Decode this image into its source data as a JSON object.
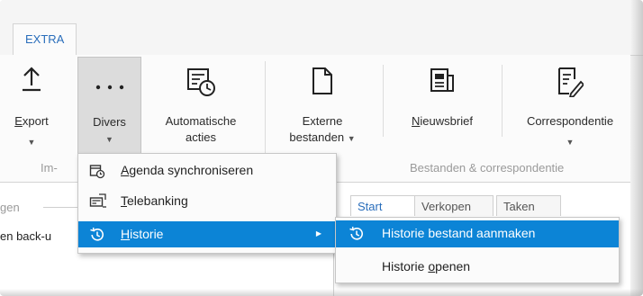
{
  "ribbon": {
    "tab_extra": "EXTRA",
    "export": {
      "label": "Export",
      "mnemonic": "E",
      "rest": "xport"
    },
    "divers": {
      "label": "Divers"
    },
    "automatische": {
      "line1": "Automatische",
      "line2": "acties"
    },
    "externe": {
      "line1": "Externe",
      "line2": "bestanden"
    },
    "nieuwsbrief": {
      "mnemonic": "N",
      "rest": "ieuwsbrief"
    },
    "correspondentie": {
      "label": "Correspondentie"
    },
    "group_im": "Im-",
    "group_bestanden": "Bestanden & correspondentie"
  },
  "left_panel": {
    "label_top": "gen",
    "label_backup": "en back-u"
  },
  "content_tabs": [
    "Start",
    "Verkopen",
    "Taken"
  ],
  "divers_menu": [
    {
      "name": "agenda",
      "mnemonic": "A",
      "rest": "genda synchroniseren",
      "icon": "calendar-sync-icon"
    },
    {
      "name": "telebanking",
      "mnemonic": "T",
      "rest": "elebanking",
      "icon": "telebanking-icon"
    },
    {
      "name": "historie",
      "mnemonic": "H",
      "rest": "istorie",
      "icon": "history-icon",
      "highlighted": true
    }
  ],
  "historie_menu": {
    "create": {
      "label": "Historie bestand aanmaken",
      "icon": "history-icon"
    },
    "open": {
      "before": "Historie ",
      "mnemonic": "o",
      "after": "penen"
    }
  },
  "colors": {
    "highlight": "#0c84d6",
    "tab_text": "#2a6ebb",
    "group_label": "#9a9a9a"
  }
}
